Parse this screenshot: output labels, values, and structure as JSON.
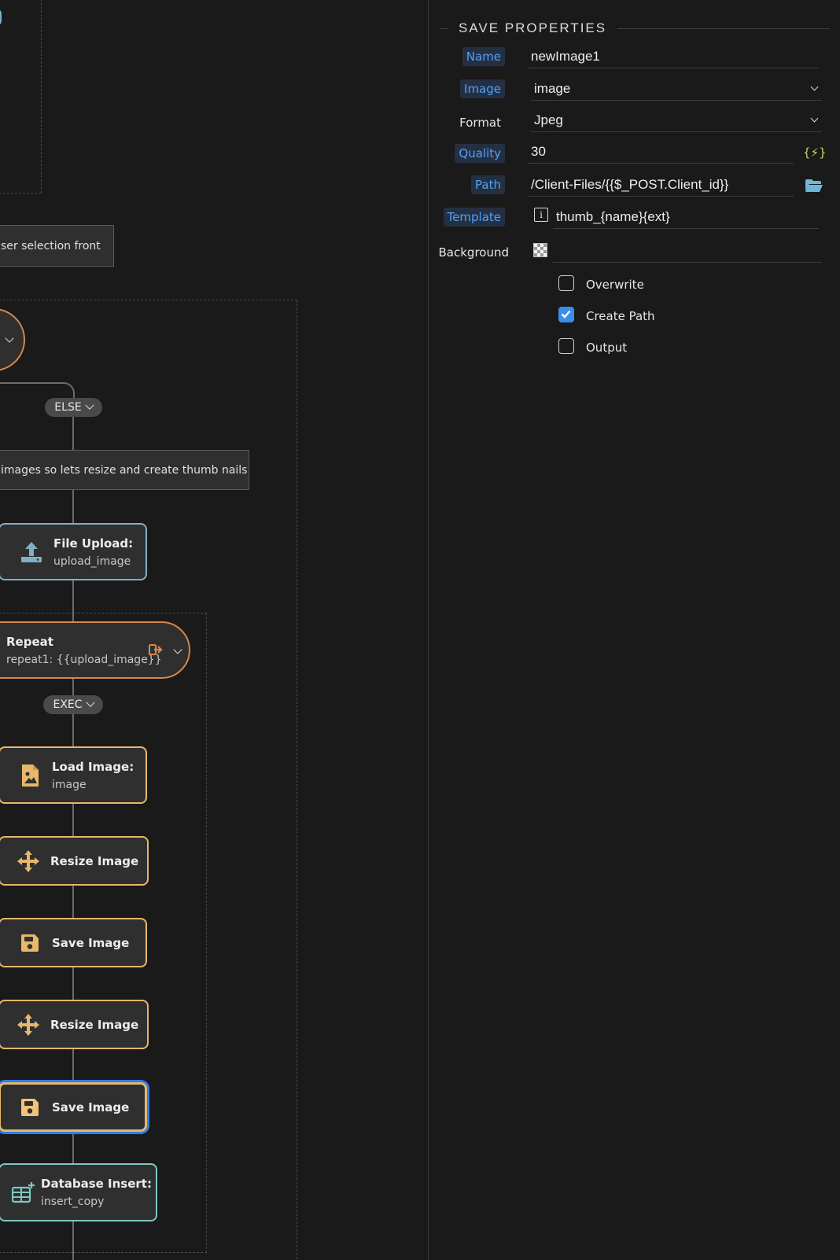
{
  "canvas": {
    "comment_top": "ser selection front",
    "comment_mid": "images so lets resize and create thumb nails",
    "else_pill": "ELSE",
    "exec_pill": "EXEC",
    "nodes": [
      {
        "title": "File Upload:",
        "subtitle": "upload_image",
        "icon": "upload-icon"
      },
      {
        "title": "Repeat",
        "subtitle": "repeat1: {{upload_image}}",
        "icon": "exit-icon"
      },
      {
        "title": "Load Image:",
        "subtitle": "image",
        "icon": "image-file-icon"
      },
      {
        "title": "Resize Image",
        "subtitle": "",
        "icon": "move-arrows-icon"
      },
      {
        "title": "Save Image",
        "subtitle": "",
        "icon": "floppy-icon"
      },
      {
        "title": "Resize Image",
        "subtitle": "",
        "icon": "move-arrows-icon"
      },
      {
        "title": "Save Image",
        "subtitle": "",
        "icon": "floppy-icon"
      },
      {
        "title": "Database Insert:",
        "subtitle": "insert_copy",
        "icon": "table-add-icon"
      }
    ]
  },
  "panel": {
    "section_title": "SAVE PROPERTIES",
    "name": {
      "label": "Name",
      "value": "newImage1"
    },
    "image": {
      "label": "Image",
      "value": "image"
    },
    "format": {
      "label": "Format",
      "value": "Jpeg"
    },
    "quality": {
      "label": "Quality",
      "value": "30",
      "button": "{⚡}"
    },
    "path": {
      "label": "Path",
      "value": "/Client-Files/{{$_POST.Client_id}}"
    },
    "template": {
      "label": "Template",
      "value": "thumb_{name}{ext}"
    },
    "background": {
      "label": "Background"
    },
    "checkboxes": [
      {
        "label": "Overwrite",
        "checked": false
      },
      {
        "label": "Create Path",
        "checked": true
      },
      {
        "label": "Output",
        "checked": false
      }
    ],
    "colors": {
      "bound_label": "#4ea1ff",
      "accent": "#3b8eea",
      "node_border": "#e8b76a"
    }
  }
}
